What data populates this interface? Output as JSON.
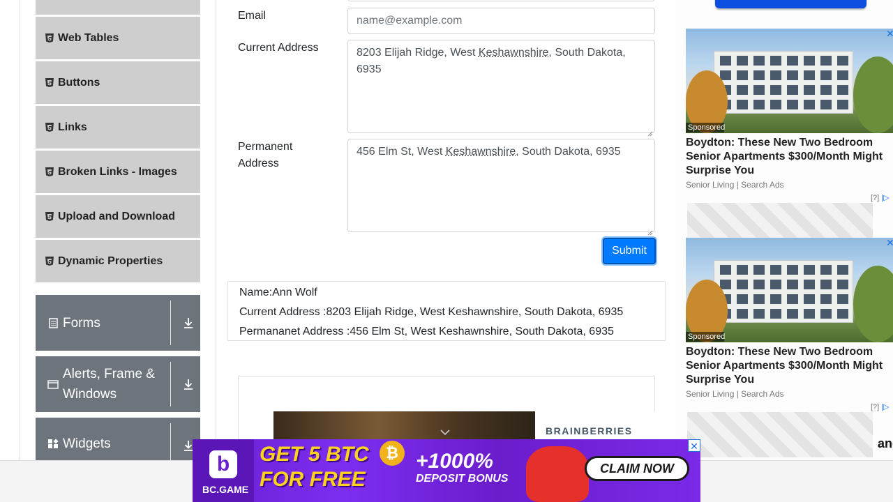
{
  "sidebar": {
    "items": [
      {
        "label": "Web Tables",
        "icon": "html5-icon"
      },
      {
        "label": "Buttons",
        "icon": "html5-icon"
      },
      {
        "label": "Links",
        "icon": "html5-icon"
      },
      {
        "label": "Broken Links - Images",
        "icon": "html5-icon"
      },
      {
        "label": "Upload and Download",
        "icon": "html5-icon"
      },
      {
        "label": "Dynamic Properties",
        "icon": "html5-icon"
      }
    ],
    "groups": [
      {
        "label": "Forms",
        "icon": "form-icon"
      },
      {
        "label": "Alerts, Frame & Windows",
        "icon": "window-icon"
      },
      {
        "label": "Widgets",
        "icon": "widgets-icon"
      }
    ]
  },
  "form": {
    "email_label": "Email",
    "email_placeholder": "name@example.com",
    "current_label": "Current Address",
    "current_value_a": "8203 Elijah Ridge, West ",
    "current_value_b": "Keshawnshire",
    "current_value_c": ", South Dakota, 6935",
    "permanent_label": "Permanent Address",
    "permanent_value_a": "456 Elm St, West ",
    "permanent_value_b": "Keshawnshire",
    "permanent_value_c": ", South Dakota, 6935",
    "submit_label": "Submit"
  },
  "output": {
    "name": "Name:Ann Wolf",
    "current": "Current Address :8203 Elijah Ridge, West Keshawnshire, South Dakota, 6935",
    "permanent": "Permananet Address :456 Elm St, West Keshawnshire, South Dakota, 6935"
  },
  "ads": {
    "cards": [
      {
        "sponsored": "Sponsored",
        "title": "Boydton: These New Two Bedroom Senior Apartments $300/Month Might Surprise You",
        "source": "Senior Living | Search Ads"
      },
      {
        "sponsored": "Sponsored",
        "title": "Boydton: These New Two Bedroom Senior Apartments $300/Month Might Surprise You",
        "source": "Senior Living | Search Ads"
      }
    ],
    "adchoice": "[?]",
    "brainberries": "BRAINBERRIES",
    "partial_text": "ang",
    "banner": {
      "logo_text": "BC.GAME",
      "line1": "GET 5 BTC",
      "line2": "FOR FREE",
      "bonus": "+1000%",
      "bonus_sub": "DEPOSIT BONUS",
      "cta": "CLAIM NOW",
      "coin_symbol": "₿",
      "logo_letter": "b"
    }
  },
  "colors": {
    "sidebar_item_bg": "#cecece",
    "group_bg": "#6d747c",
    "submit_bg": "#007bff",
    "banner_bg": "#6a1fd0"
  }
}
